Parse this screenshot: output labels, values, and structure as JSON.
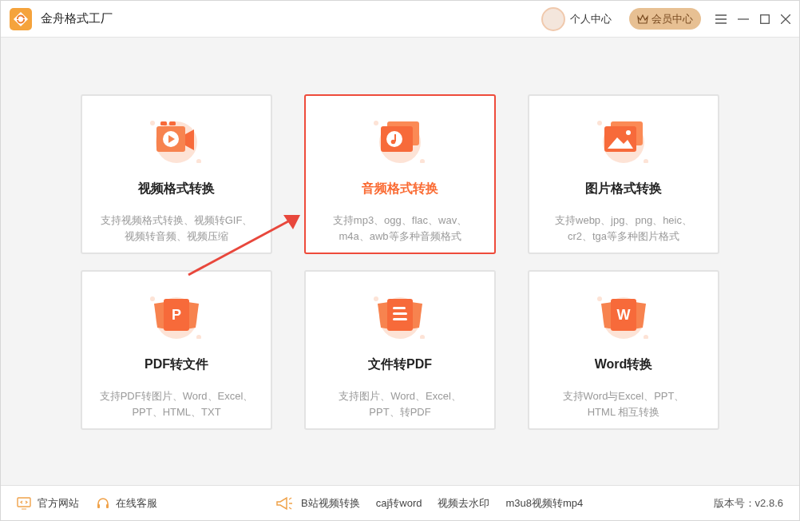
{
  "window": {
    "title": "金舟格式工厂",
    "user_label": "个人中心",
    "vip_button": "会员中心"
  },
  "cards": [
    {
      "kind": "video",
      "title": "视频格式转换",
      "description": [
        "支持视频格式转换、视频转GIF、",
        "视频转音频、视频压缩"
      ],
      "selected": false
    },
    {
      "kind": "audio",
      "title": "音频格式转换",
      "description": [
        "支持mp3、ogg、flac、wav、",
        "m4a、awb等多种音频格式"
      ],
      "selected": true
    },
    {
      "kind": "image",
      "title": "图片格式转换",
      "description": [
        "支持webp、jpg、png、heic、",
        "cr2、tga等多种图片格式"
      ],
      "selected": false
    },
    {
      "kind": "pdf",
      "icon_letter": "P",
      "title": "PDF转文件",
      "description": [
        "支持PDF转图片、Word、Excel、",
        "PPT、HTML、TXT"
      ],
      "selected": false
    },
    {
      "kind": "doc",
      "title": "文件转PDF",
      "description": [
        "支持图片、Word、Excel、",
        "PPT、转PDF"
      ],
      "selected": false
    },
    {
      "kind": "word",
      "icon_letter": "W",
      "title": "Word转换",
      "description": [
        "支持Word与Excel、PPT、",
        "HTML 相互转换"
      ],
      "selected": false
    }
  ],
  "footer": {
    "links": [
      {
        "kind": "website",
        "label": "官方网站"
      },
      {
        "kind": "service",
        "label": "在线客服"
      }
    ],
    "promo_links": [
      "B站视频转换",
      "caj转word",
      "视频去水印",
      "m3u8视频转mp4"
    ],
    "version": "版本号：v2.8.6"
  }
}
